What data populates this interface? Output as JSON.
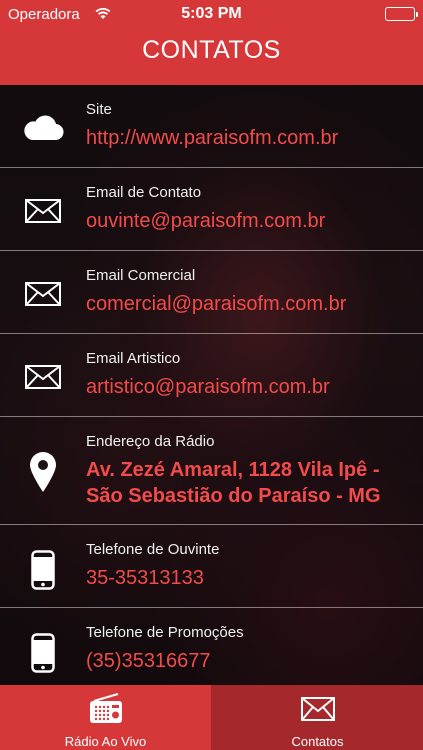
{
  "status_bar": {
    "carrier": "Operadora",
    "time": "5:03 PM"
  },
  "nav": {
    "title": "CONTATOS"
  },
  "contacts": [
    {
      "label": "Site",
      "value": "http://www.paraisofm.com.br",
      "icon": "cloud-icon"
    },
    {
      "label": "Email de Contato",
      "value": "ouvinte@paraisofm.com.br",
      "icon": "envelope-icon"
    },
    {
      "label": "Email Comercial",
      "value": "comercial@paraisofm.com.br",
      "icon": "envelope-icon"
    },
    {
      "label": "Email Artistico",
      "value": "artistico@paraisofm.com.br",
      "icon": "envelope-icon"
    },
    {
      "label": "Endereço da Rádio",
      "value_line1": "Av. Zezé Amaral, 1128 Vila Ipê -",
      "value_line2": "São Sebastião do Paraíso - MG",
      "icon": "location-pin-icon"
    },
    {
      "label": "Telefone de Ouvinte",
      "value": "35-35313133",
      "icon": "phone-icon"
    },
    {
      "label": "Telefone de Promoções",
      "value": "(35)35316677",
      "icon": "phone-icon"
    }
  ],
  "tabs": [
    {
      "label": "Rádio Ao Vivo",
      "icon": "radio-icon",
      "active": true
    },
    {
      "label": "Contatos",
      "icon": "envelope-icon",
      "active": false
    }
  ],
  "colors": {
    "primary": "#d6383a",
    "tab_inactive": "#a5292c",
    "value_text": "#f24b4b"
  }
}
